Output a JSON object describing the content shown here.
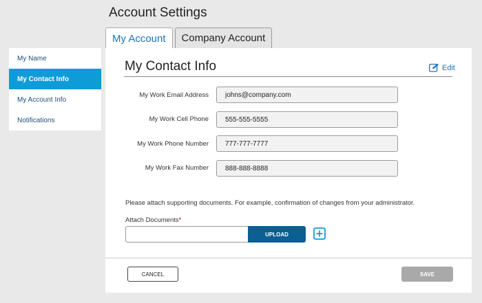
{
  "page": {
    "title": "Account Settings"
  },
  "tabs": [
    {
      "label": "My Account",
      "active": true
    },
    {
      "label": "Company Account",
      "active": false
    }
  ],
  "sidebar": {
    "items": [
      {
        "label": "My Name",
        "active": false
      },
      {
        "label": "My Contact Info",
        "active": true
      },
      {
        "label": "My Account Info",
        "active": false
      },
      {
        "label": "Notifications",
        "active": false
      }
    ]
  },
  "main": {
    "title": "My Contact Info",
    "edit_label": "Edit",
    "edit_icon": "edit-pencil-icon",
    "fields": [
      {
        "label": "My Work Email  Address",
        "value": "johns@company.com"
      },
      {
        "label": "My Work Cell Phone",
        "value": "555-555-5555"
      },
      {
        "label": "My Work Phone Number",
        "value": "777-777-7777"
      },
      {
        "label": "My Work Fax Number",
        "value": "888-888-8888"
      }
    ],
    "note": "Please attach supporting documents. For example, confirmation of changes from your administrator.",
    "attach_label": "Attach Documents",
    "required_marker": "*",
    "attach_value": "",
    "upload_label": "UPLOAD",
    "add_icon": "plus-square-icon",
    "cancel_label": "CANCEL",
    "save_label": "SAVE"
  },
  "colors": {
    "accent": "#0d9cd8",
    "link": "#1b75bb",
    "upload": "#0b5f93",
    "save_disabled": "#a9a9a9",
    "background": "#e9e9e9"
  }
}
